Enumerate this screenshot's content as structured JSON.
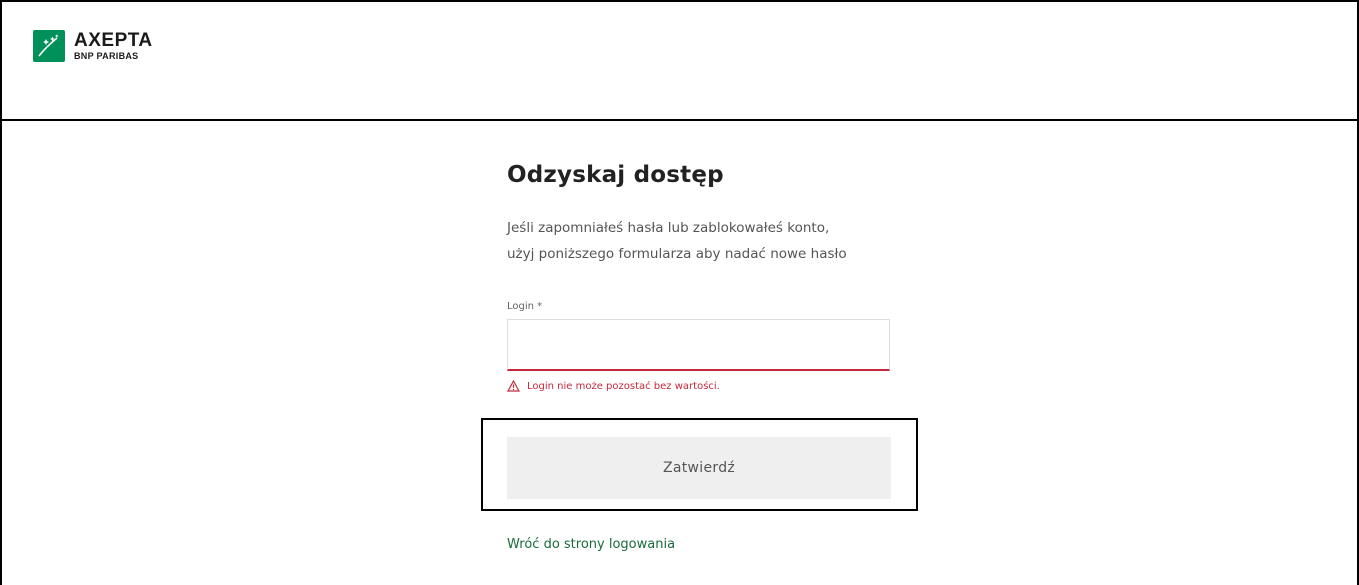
{
  "brand": {
    "name": "AXEPTA",
    "subtitle": "BNP PARIBAS",
    "color": "#00915a"
  },
  "form": {
    "title": "Odzyskaj dostęp",
    "description_line1": "Jeśli zapomniałeś hasła lub zablokowałeś konto,",
    "description_line2": "użyj poniższego formularza aby nadać nowe hasło",
    "login_label": "Login *",
    "login_value": "",
    "error_message": "Login nie może pozostać bez wartości.",
    "error_color": "#c5283d",
    "submit_label": "Zatwierdź",
    "back_link": "Wróć do strony logowania",
    "link_color": "#1a6b3c"
  }
}
